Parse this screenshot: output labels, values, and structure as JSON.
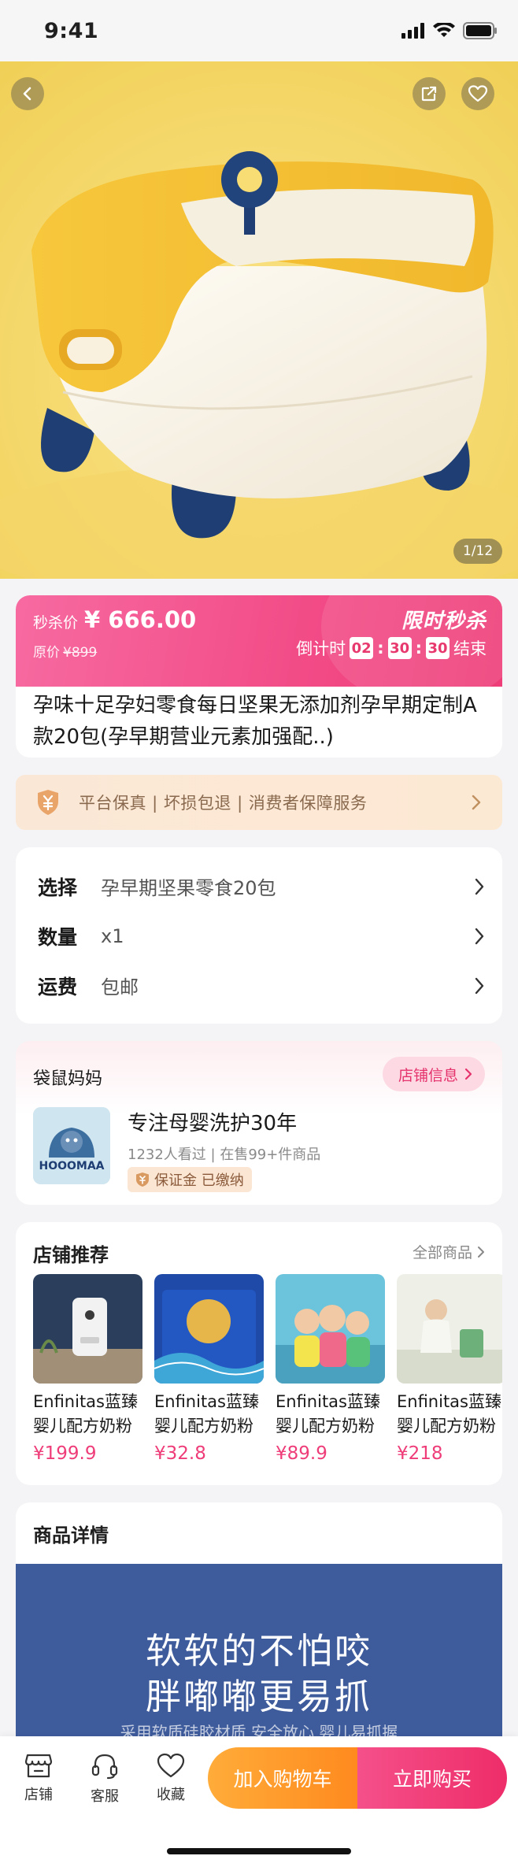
{
  "status_bar": {
    "time": "9:41"
  },
  "hero": {
    "page_indicator": "1/12"
  },
  "flash_sale": {
    "price_label": "秒杀价",
    "price": "¥ 666.00",
    "original_label": "原价",
    "original_price": "¥899",
    "title": "限时秒杀",
    "countdown_label": "倒计时",
    "hours": "02",
    "minutes": "30",
    "seconds": "30",
    "end_label": "结束"
  },
  "product": {
    "title": "孕味十足孕妇零食每日坚果无添加剂孕早期定制A款20包(孕早期营业元素加强配..)"
  },
  "guarantee": {
    "text": "平台保真 | 坏损包退 | 消费者保障服务"
  },
  "specs": [
    {
      "key": "选择",
      "value": "孕早期坚果零食20包"
    },
    {
      "key": "数量",
      "value": "x1"
    },
    {
      "key": "运费",
      "value": "包邮"
    }
  ],
  "shop": {
    "name": "袋鼠妈妈",
    "info_button": "店铺信息",
    "logo_text": "HOOOMAA",
    "slogan": "专注母婴洗护30年",
    "stats": "1232人看过 | 在售99+件商品",
    "badge": "保证金 已缴纳"
  },
  "recommend": {
    "title": "店铺推荐",
    "all_label": "全部商品",
    "items": [
      {
        "name": "Enfinitas蓝臻婴儿配方奶粉",
        "price": "¥199.9"
      },
      {
        "name": "Enfinitas蓝臻婴儿配方奶粉",
        "price": "¥32.8"
      },
      {
        "name": "Enfinitas蓝臻婴儿配方奶粉",
        "price": "¥89.9"
      },
      {
        "name": "Enfinitas蓝臻婴儿配方奶粉",
        "price": "¥218"
      }
    ]
  },
  "details": {
    "title": "商品详情",
    "headline_1": "软软的不怕咬",
    "headline_2": "胖嘟嘟更易抓",
    "subtext": "采用软质硅胶材质 安全放心 婴儿易抓握"
  },
  "bottom_bar": {
    "shop_label": "店铺",
    "service_label": "客服",
    "favorite_label": "收藏",
    "cart_button": "加入购物车",
    "buy_button": "立即购买"
  },
  "colors": {
    "accent_pink": "#ee3d78",
    "accent_orange": "#ff8a1e",
    "detail_blue": "#3e5b9c"
  }
}
